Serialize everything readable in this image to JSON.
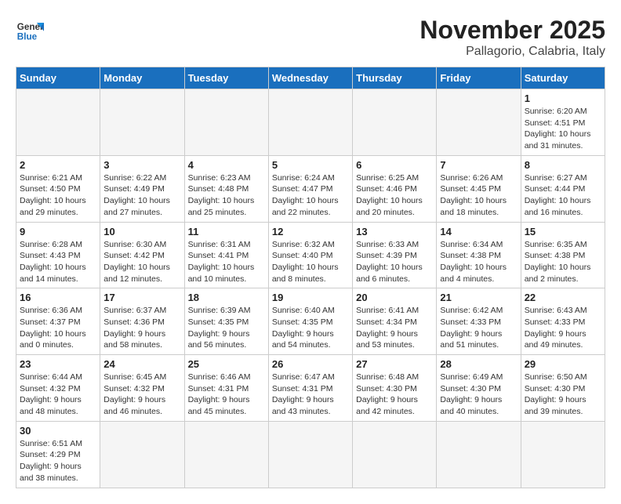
{
  "header": {
    "logo_general": "General",
    "logo_blue": "Blue",
    "month_title": "November 2025",
    "location": "Pallagorio, Calabria, Italy"
  },
  "days_of_week": [
    "Sunday",
    "Monday",
    "Tuesday",
    "Wednesday",
    "Thursday",
    "Friday",
    "Saturday"
  ],
  "weeks": [
    [
      {
        "day": "",
        "info": ""
      },
      {
        "day": "",
        "info": ""
      },
      {
        "day": "",
        "info": ""
      },
      {
        "day": "",
        "info": ""
      },
      {
        "day": "",
        "info": ""
      },
      {
        "day": "",
        "info": ""
      },
      {
        "day": "1",
        "info": "Sunrise: 6:20 AM\nSunset: 4:51 PM\nDaylight: 10 hours\nand 31 minutes."
      }
    ],
    [
      {
        "day": "2",
        "info": "Sunrise: 6:21 AM\nSunset: 4:50 PM\nDaylight: 10 hours\nand 29 minutes."
      },
      {
        "day": "3",
        "info": "Sunrise: 6:22 AM\nSunset: 4:49 PM\nDaylight: 10 hours\nand 27 minutes."
      },
      {
        "day": "4",
        "info": "Sunrise: 6:23 AM\nSunset: 4:48 PM\nDaylight: 10 hours\nand 25 minutes."
      },
      {
        "day": "5",
        "info": "Sunrise: 6:24 AM\nSunset: 4:47 PM\nDaylight: 10 hours\nand 22 minutes."
      },
      {
        "day": "6",
        "info": "Sunrise: 6:25 AM\nSunset: 4:46 PM\nDaylight: 10 hours\nand 20 minutes."
      },
      {
        "day": "7",
        "info": "Sunrise: 6:26 AM\nSunset: 4:45 PM\nDaylight: 10 hours\nand 18 minutes."
      },
      {
        "day": "8",
        "info": "Sunrise: 6:27 AM\nSunset: 4:44 PM\nDaylight: 10 hours\nand 16 minutes."
      }
    ],
    [
      {
        "day": "9",
        "info": "Sunrise: 6:28 AM\nSunset: 4:43 PM\nDaylight: 10 hours\nand 14 minutes."
      },
      {
        "day": "10",
        "info": "Sunrise: 6:30 AM\nSunset: 4:42 PM\nDaylight: 10 hours\nand 12 minutes."
      },
      {
        "day": "11",
        "info": "Sunrise: 6:31 AM\nSunset: 4:41 PM\nDaylight: 10 hours\nand 10 minutes."
      },
      {
        "day": "12",
        "info": "Sunrise: 6:32 AM\nSunset: 4:40 PM\nDaylight: 10 hours\nand 8 minutes."
      },
      {
        "day": "13",
        "info": "Sunrise: 6:33 AM\nSunset: 4:39 PM\nDaylight: 10 hours\nand 6 minutes."
      },
      {
        "day": "14",
        "info": "Sunrise: 6:34 AM\nSunset: 4:38 PM\nDaylight: 10 hours\nand 4 minutes."
      },
      {
        "day": "15",
        "info": "Sunrise: 6:35 AM\nSunset: 4:38 PM\nDaylight: 10 hours\nand 2 minutes."
      }
    ],
    [
      {
        "day": "16",
        "info": "Sunrise: 6:36 AM\nSunset: 4:37 PM\nDaylight: 10 hours\nand 0 minutes."
      },
      {
        "day": "17",
        "info": "Sunrise: 6:37 AM\nSunset: 4:36 PM\nDaylight: 9 hours\nand 58 minutes."
      },
      {
        "day": "18",
        "info": "Sunrise: 6:39 AM\nSunset: 4:35 PM\nDaylight: 9 hours\nand 56 minutes."
      },
      {
        "day": "19",
        "info": "Sunrise: 6:40 AM\nSunset: 4:35 PM\nDaylight: 9 hours\nand 54 minutes."
      },
      {
        "day": "20",
        "info": "Sunrise: 6:41 AM\nSunset: 4:34 PM\nDaylight: 9 hours\nand 53 minutes."
      },
      {
        "day": "21",
        "info": "Sunrise: 6:42 AM\nSunset: 4:33 PM\nDaylight: 9 hours\nand 51 minutes."
      },
      {
        "day": "22",
        "info": "Sunrise: 6:43 AM\nSunset: 4:33 PM\nDaylight: 9 hours\nand 49 minutes."
      }
    ],
    [
      {
        "day": "23",
        "info": "Sunrise: 6:44 AM\nSunset: 4:32 PM\nDaylight: 9 hours\nand 48 minutes."
      },
      {
        "day": "24",
        "info": "Sunrise: 6:45 AM\nSunset: 4:32 PM\nDaylight: 9 hours\nand 46 minutes."
      },
      {
        "day": "25",
        "info": "Sunrise: 6:46 AM\nSunset: 4:31 PM\nDaylight: 9 hours\nand 45 minutes."
      },
      {
        "day": "26",
        "info": "Sunrise: 6:47 AM\nSunset: 4:31 PM\nDaylight: 9 hours\nand 43 minutes."
      },
      {
        "day": "27",
        "info": "Sunrise: 6:48 AM\nSunset: 4:30 PM\nDaylight: 9 hours\nand 42 minutes."
      },
      {
        "day": "28",
        "info": "Sunrise: 6:49 AM\nSunset: 4:30 PM\nDaylight: 9 hours\nand 40 minutes."
      },
      {
        "day": "29",
        "info": "Sunrise: 6:50 AM\nSunset: 4:30 PM\nDaylight: 9 hours\nand 39 minutes."
      }
    ],
    [
      {
        "day": "30",
        "info": "Sunrise: 6:51 AM\nSunset: 4:29 PM\nDaylight: 9 hours\nand 38 minutes."
      },
      {
        "day": "",
        "info": ""
      },
      {
        "day": "",
        "info": ""
      },
      {
        "day": "",
        "info": ""
      },
      {
        "day": "",
        "info": ""
      },
      {
        "day": "",
        "info": ""
      },
      {
        "day": "",
        "info": ""
      }
    ]
  ]
}
